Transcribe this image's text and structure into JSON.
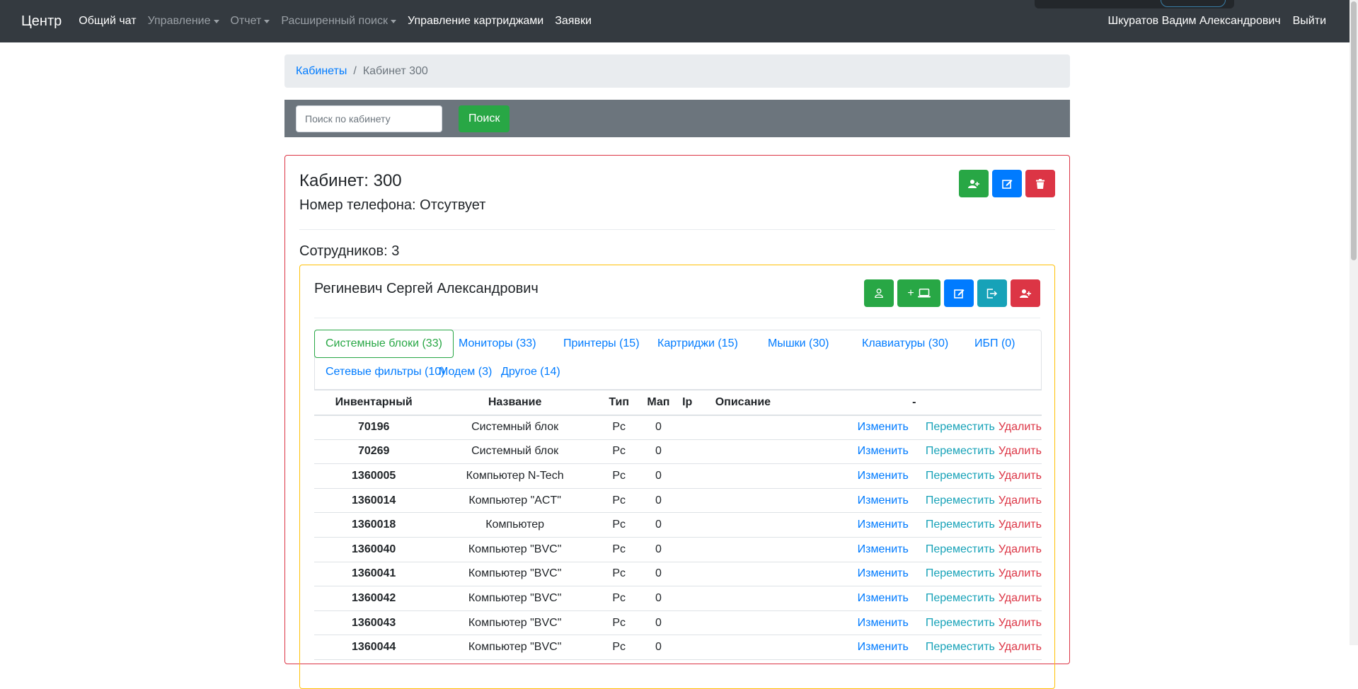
{
  "navbar": {
    "brand": "Центр",
    "links": [
      {
        "label": "Общий чат",
        "style": "light",
        "dropdown": false
      },
      {
        "label": "Управление",
        "style": "muted",
        "dropdown": true
      },
      {
        "label": "Отчет",
        "style": "muted",
        "dropdown": true
      },
      {
        "label": "Расширенный поиск",
        "style": "muted",
        "dropdown": true
      },
      {
        "label": "Управление картриджами",
        "style": "light",
        "dropdown": false
      },
      {
        "label": "Заявки",
        "style": "light",
        "dropdown": false
      }
    ],
    "user": "Шкуратов Вадим Александрович",
    "logout": "Выйти"
  },
  "breadcrumb": {
    "parent": "Кабинеты",
    "separator": "/",
    "current": "Кабинет 300"
  },
  "search": {
    "placeholder": "Поиск по кабинету",
    "button": "Поиск"
  },
  "cabinet": {
    "title": "Кабинет: 300",
    "phone": "Номер телефона: Отсутвует",
    "employees_count": "Сотрудников: 3",
    "actions": [
      {
        "icon": "user-plus-icon",
        "color": "#28a745"
      },
      {
        "icon": "edit-icon",
        "color": "#007bff"
      },
      {
        "icon": "trash-icon",
        "color": "#dc3545"
      }
    ]
  },
  "employee": {
    "name": "Региневич Сергей Александрович",
    "actions": [
      {
        "icon": "user-icon",
        "color": "#28a745"
      },
      {
        "icon": "add-computer-icon",
        "label": "+",
        "color": "#28a745"
      },
      {
        "icon": "edit-icon",
        "color": "#007bff"
      },
      {
        "icon": "sign-out-icon",
        "color": "#17a2b8"
      },
      {
        "icon": "user-plus-icon",
        "color": "#dc3545"
      }
    ],
    "tabs": [
      {
        "label": "Системные блоки (33)",
        "active": true
      },
      {
        "label": "Мониторы (33)"
      },
      {
        "label": "Принтеры (15)"
      },
      {
        "label": "Картриджи (15)"
      },
      {
        "label": "Мышки (30)"
      },
      {
        "label": "Клавиатуры (30)"
      },
      {
        "label": "ИБП (0)"
      },
      {
        "label": "Сетевые фильтры (10)"
      },
      {
        "label": "Модем (3)"
      },
      {
        "label": "Другое (14)"
      }
    ],
    "table": {
      "headers": [
        "Инвентарный",
        "Название",
        "Тип",
        "Мап",
        "Ip",
        "Описание",
        "-"
      ],
      "action_labels": {
        "edit": "Изменить",
        "move": "Переместить",
        "delete": "Удалить"
      },
      "rows": [
        {
          "inv": "70196",
          "name": "Системный блок",
          "type": "Pc",
          "map": "0",
          "ip": "",
          "desc": ""
        },
        {
          "inv": "70269",
          "name": "Системный блок",
          "type": "Pc",
          "map": "0",
          "ip": "",
          "desc": ""
        },
        {
          "inv": "1360005",
          "name": "Компьютер N-Tech",
          "type": "Pc",
          "map": "0",
          "ip": "",
          "desc": ""
        },
        {
          "inv": "1360014",
          "name": "Компьютер \"ACT\"",
          "type": "Pc",
          "map": "0",
          "ip": "",
          "desc": ""
        },
        {
          "inv": "1360018",
          "name": "Компьютер",
          "type": "Pc",
          "map": "0",
          "ip": "",
          "desc": ""
        },
        {
          "inv": "1360040",
          "name": "Компьютер \"BVC\"",
          "type": "Pc",
          "map": "0",
          "ip": "",
          "desc": ""
        },
        {
          "inv": "1360041",
          "name": "Компьютер \"BVC\"",
          "type": "Pc",
          "map": "0",
          "ip": "",
          "desc": ""
        },
        {
          "inv": "1360042",
          "name": "Компьютер \"BVC\"",
          "type": "Pc",
          "map": "0",
          "ip": "",
          "desc": ""
        },
        {
          "inv": "1360043",
          "name": "Компьютер \"BVC\"",
          "type": "Pc",
          "map": "0",
          "ip": "",
          "desc": ""
        },
        {
          "inv": "1360044",
          "name": "Компьютер \"BVC\"",
          "type": "Pc",
          "map": "0",
          "ip": "",
          "desc": ""
        }
      ]
    }
  }
}
